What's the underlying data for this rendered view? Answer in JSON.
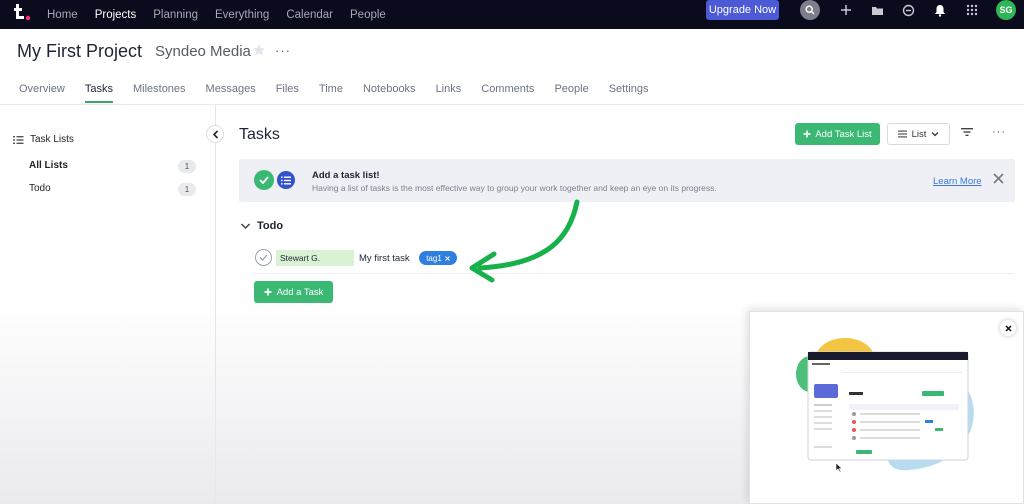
{
  "topnav": {
    "logo_alt": "t.",
    "items": [
      "Home",
      "Projects",
      "Planning",
      "Everything",
      "Calendar",
      "People"
    ],
    "active": "Projects",
    "upgrade_label": "Upgrade Now",
    "avatar_initials": "SG",
    "icons": [
      "search-icon",
      "plus-icon",
      "folder-icon",
      "clock-icon",
      "bell-icon",
      "apps-grid-icon"
    ]
  },
  "project": {
    "title": "My First Project",
    "company": "Syndeo Media",
    "more": "···"
  },
  "tabs": [
    "Overview",
    "Tasks",
    "Milestones",
    "Messages",
    "Files",
    "Time",
    "Notebooks",
    "Links",
    "Comments",
    "People",
    "Settings"
  ],
  "active_tab": "Tasks",
  "sidebar": {
    "heading": "Task Lists",
    "items": [
      {
        "label": "All Lists",
        "count": "1"
      },
      {
        "label": "Todo",
        "count": "1"
      }
    ]
  },
  "main": {
    "title": "Tasks",
    "add_list_label": "Add Task List",
    "view_label": "List",
    "more": "···"
  },
  "banner": {
    "title": "Add a task list!",
    "text": "Having a list of tasks is the most effective way to group your work together and keep an eye on its progress.",
    "learn_more": "Learn More"
  },
  "group": {
    "title": "Todo",
    "tasks": [
      {
        "assignee": "Stewart G.",
        "name": "My first task",
        "tag": "tag1"
      }
    ],
    "add_task_label": "Add a Task"
  },
  "colors": {
    "topbar": "#0b0b1e",
    "accent_green": "#3bb874",
    "upgrade_blue": "#4c5ad6",
    "tag_blue": "#2f7fe0",
    "arrow_green": "#17b04a"
  }
}
